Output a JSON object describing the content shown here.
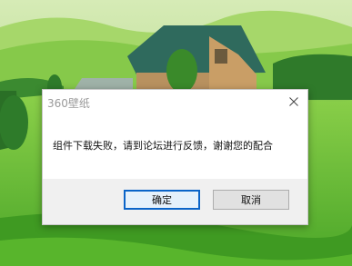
{
  "dialog": {
    "title": "360壁纸",
    "message": "组件下载失败，请到论坛进行反馈，谢谢您的配合",
    "ok_label": "确定",
    "cancel_label": "取消"
  },
  "icons": {
    "close": "close-icon"
  },
  "colors": {
    "sky": "#cfe8b0",
    "field": "#6cbf32",
    "roof": "#2f6a5d",
    "wall": "#b8915f",
    "accent": "#0a64c8"
  }
}
